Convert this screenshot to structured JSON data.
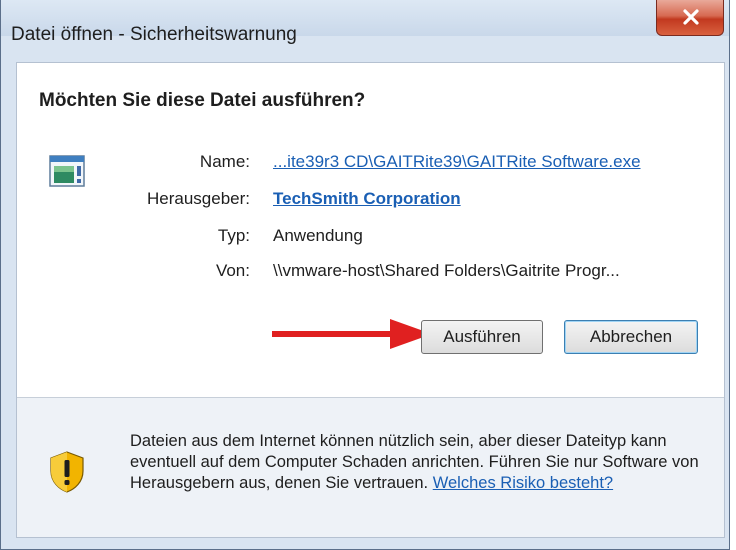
{
  "window": {
    "title": "Datei öffnen - Sicherheitswarnung"
  },
  "dialog": {
    "question": "Möchten Sie diese Datei ausführen?",
    "fields": {
      "name_label": "Name:",
      "name_value": "...ite39r3 CD\\GAITRite39\\GAITRite Software.exe",
      "publisher_label": "Herausgeber:",
      "publisher_value": "TechSmith Corporation",
      "type_label": "Typ:",
      "type_value": "Anwendung",
      "from_label": "Von:",
      "from_value": "\\\\vmware-host\\Shared Folders\\Gaitrite Progr..."
    },
    "buttons": {
      "run": "Ausführen",
      "cancel": "Abbrechen"
    },
    "warning": {
      "text": "Dateien aus dem Internet können nützlich sein, aber dieser Dateityp kann eventuell auf dem Computer Schaden anrichten. Führen Sie nur Software von Herausgebern aus, denen Sie vertrauen.",
      "link": "Welches Risiko besteht?"
    }
  },
  "icons": [
    "close-icon",
    "application-icon",
    "red-arrow-annotation",
    "shield-warning-icon"
  ],
  "colors": {
    "link": "#1a5fb4",
    "arrow": "#e02020",
    "close_button": "#c2391f"
  }
}
